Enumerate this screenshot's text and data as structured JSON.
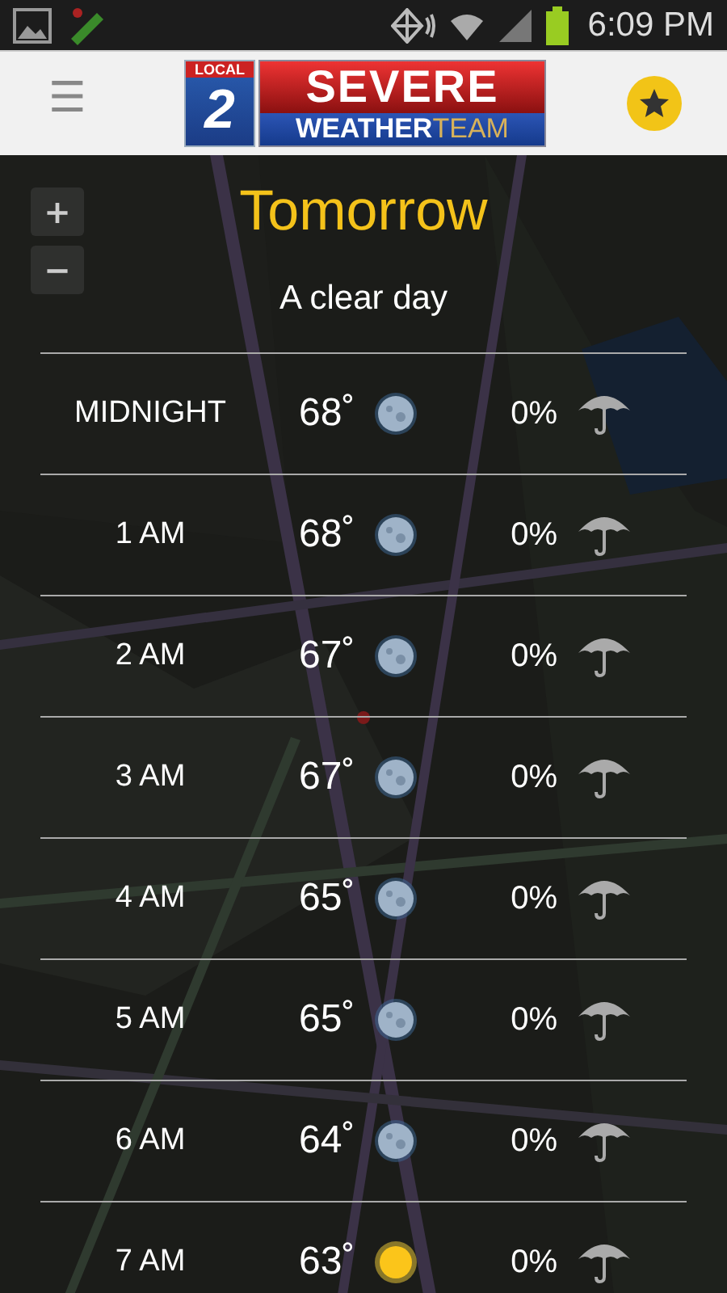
{
  "status_bar": {
    "time": "6:09 PM"
  },
  "app_bar": {
    "menu_icon": "☰",
    "logo": {
      "badge_text": "LOCAL",
      "badge_number": "2",
      "title": "SEVERE",
      "subtitle_1": "WEATHER",
      "subtitle_2": "TEAM"
    }
  },
  "map": {
    "kind": "picture",
    "zoom_controls": [
      "+",
      "−"
    ]
  },
  "forecast": {
    "day": "Tomorrow",
    "summary": "A clear day",
    "rows": [
      {
        "time": "MIDNIGHT",
        "temp": "68˚",
        "kind": "moon",
        "precip": "0%"
      },
      {
        "time": "1 AM",
        "temp": "68˚",
        "kind": "moon",
        "precip": "0%"
      },
      {
        "time": "2 AM",
        "temp": "67˚",
        "kind": "moon",
        "precip": "0%"
      },
      {
        "time": "3 AM",
        "temp": "67˚",
        "kind": "moon",
        "precip": "0%"
      },
      {
        "time": "4 AM",
        "temp": "65˚",
        "kind": "moon",
        "precip": "0%"
      },
      {
        "time": "5 AM",
        "temp": "65˚",
        "kind": "moon",
        "precip": "0%"
      },
      {
        "time": "6 AM",
        "temp": "64˚",
        "kind": "moon",
        "precip": "0%"
      },
      {
        "time": "7 AM",
        "temp": "63˚",
        "kind": "sun",
        "precip": "0%"
      }
    ]
  }
}
